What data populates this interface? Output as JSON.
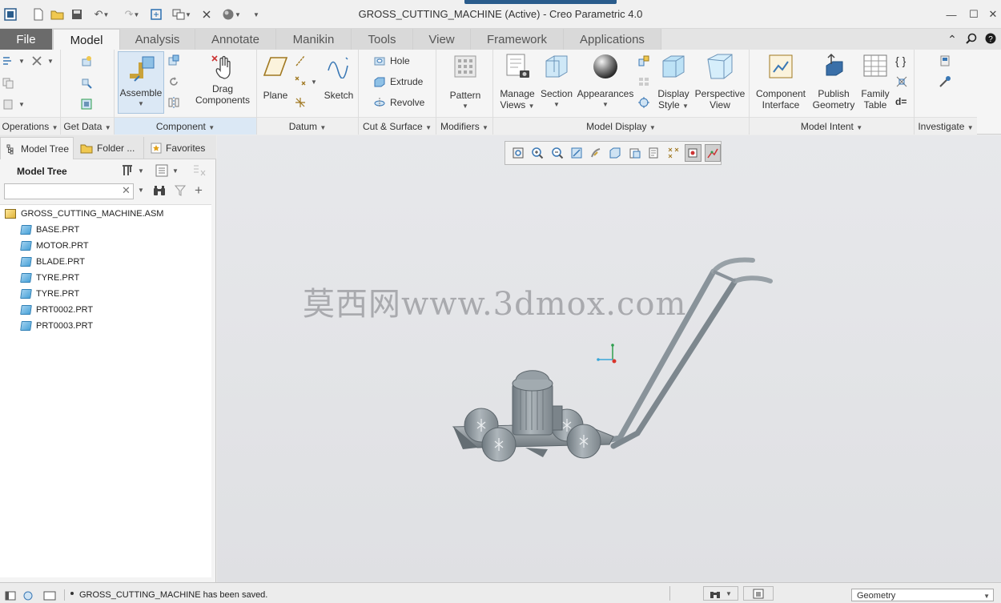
{
  "window": {
    "title": "GROSS_CUTTING_MACHINE (Active) - Creo Parametric 4.0",
    "minimize": "—",
    "maximize": "☐",
    "close": "✕"
  },
  "tabs": [
    {
      "label": "File"
    },
    {
      "label": "Model"
    },
    {
      "label": "Analysis"
    },
    {
      "label": "Annotate"
    },
    {
      "label": "Manikin"
    },
    {
      "label": "Tools"
    },
    {
      "label": "View"
    },
    {
      "label": "Framework"
    },
    {
      "label": "Applications"
    }
  ],
  "ribbon": {
    "groups": {
      "operations": "Operations",
      "get_data": "Get Data",
      "component": "Component",
      "datum": "Datum",
      "cut_surface": "Cut & Surface",
      "modifiers": "Modifiers",
      "model_display": "Model Display",
      "model_intent": "Model Intent",
      "investigate": "Investigate"
    },
    "buttons": {
      "assemble": "Assemble",
      "drag": "Drag",
      "components": "Components",
      "plane": "Plane",
      "sketch": "Sketch",
      "hole": "Hole",
      "extrude": "Extrude",
      "revolve": "Revolve",
      "pattern": "Pattern",
      "manage": "Manage",
      "views": "Views",
      "section": "Section",
      "appearances": "Appearances",
      "display": "Display",
      "style": "Style",
      "perspective": "Perspective",
      "view": "View",
      "component": "Component",
      "interface": "Interface",
      "publish": "Publish",
      "geometry": "Geometry",
      "family": "Family",
      "table": "Table",
      "d_eq": "d="
    }
  },
  "panel": {
    "tabs": [
      {
        "label": "Model Tree"
      },
      {
        "label": "Folder ..."
      },
      {
        "label": "Favorites"
      }
    ],
    "tree_title": "Model Tree",
    "search_placeholder": "",
    "tree": [
      {
        "name": "GROSS_CUTTING_MACHINE.ASM",
        "type": "asm"
      },
      {
        "name": "BASE.PRT",
        "type": "prt"
      },
      {
        "name": "MOTOR.PRT",
        "type": "prt"
      },
      {
        "name": "BLADE.PRT",
        "type": "prt"
      },
      {
        "name": "TYRE.PRT",
        "type": "prt"
      },
      {
        "name": "TYRE.PRT",
        "type": "prt"
      },
      {
        "name": "PRT0002.PRT",
        "type": "prt"
      },
      {
        "name": "PRT0003.PRT",
        "type": "prt"
      }
    ]
  },
  "viewport": {
    "watermark": "莫西网www.3dmox.com"
  },
  "status": {
    "message": "GROSS_CUTTING_MACHINE has been saved.",
    "filter": "Geometry"
  },
  "colors": {
    "file_tab": "#6b6b6b",
    "component_group_highlight": "#dbe8f5",
    "model_gray": "#8e979c"
  }
}
